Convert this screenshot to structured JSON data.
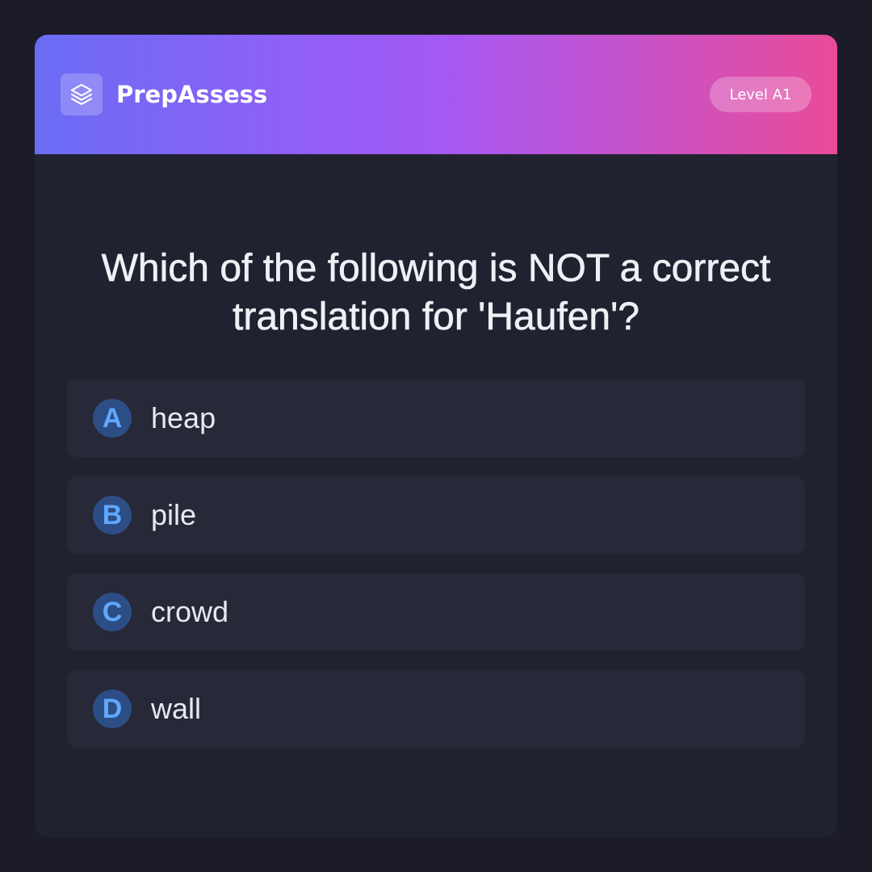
{
  "header": {
    "brand": "PrepAssess",
    "logo_icon": "layers-icon",
    "level": "Level A1",
    "gradient": [
      "#6a6cf5",
      "#a459f6",
      "#e94b9a"
    ]
  },
  "question": {
    "text": "Which of the following is NOT a correct translation for 'Haufen'?"
  },
  "options": [
    {
      "letter": "A",
      "text": "heap"
    },
    {
      "letter": "B",
      "text": "pile"
    },
    {
      "letter": "C",
      "text": "crowd"
    },
    {
      "letter": "D",
      "text": "wall"
    }
  ],
  "colors": {
    "background": "#1b1c27",
    "card": "#20222f",
    "option_bg": "#272938",
    "letter_bg": "#2d4d85",
    "letter_fg": "#5fa8ff"
  }
}
